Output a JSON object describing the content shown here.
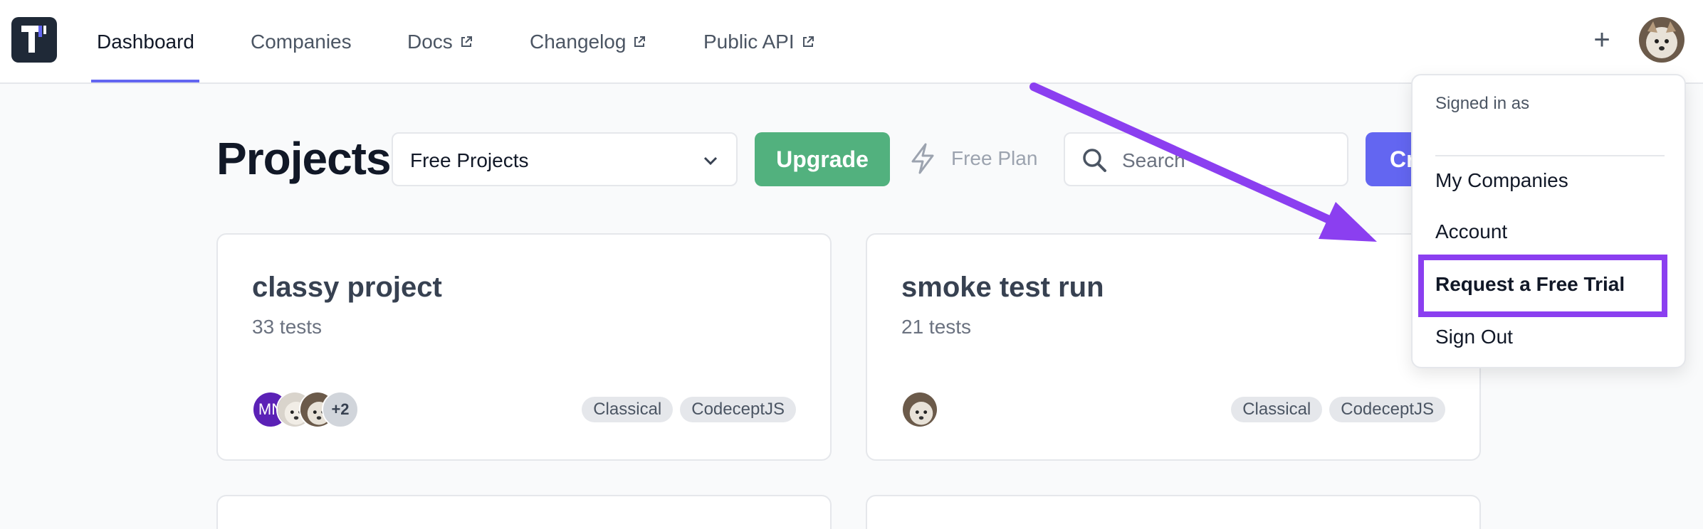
{
  "nav": {
    "items": [
      {
        "label": "Dashboard",
        "active": true,
        "external": false
      },
      {
        "label": "Companies",
        "active": false,
        "external": false
      },
      {
        "label": "Docs",
        "active": false,
        "external": true
      },
      {
        "label": "Changelog",
        "active": false,
        "external": true
      },
      {
        "label": "Public API",
        "active": false,
        "external": true
      }
    ],
    "add_symbol": "+"
  },
  "toolbar": {
    "title": "Projects",
    "project_filter": "Free Projects",
    "upgrade_label": "Upgrade",
    "plan_label": "Free Plan",
    "search_placeholder": "Search",
    "create_label": "Cr"
  },
  "projects": [
    {
      "name": "classy project",
      "tests": "33 tests",
      "member_initials": "MN",
      "members_more": "+2",
      "tags": [
        "Classical",
        "CodeceptJS"
      ]
    },
    {
      "name": "smoke test run",
      "tests": "21 tests",
      "tags": [
        "Classical",
        "CodeceptJS"
      ]
    }
  ],
  "user_menu": {
    "signed_in_label": "Signed in as",
    "items": [
      {
        "label": "My Companies",
        "highlighted": false
      },
      {
        "label": "Account",
        "highlighted": false
      },
      {
        "label": "Request a Free Trial",
        "highlighted": true
      },
      {
        "label": "Sign Out",
        "highlighted": false
      }
    ]
  },
  "colors": {
    "accent": "#6366f1",
    "upgrade_green": "#52b17e",
    "annotation_purple": "#8b3ff0",
    "logo_bg": "#1f2937"
  }
}
